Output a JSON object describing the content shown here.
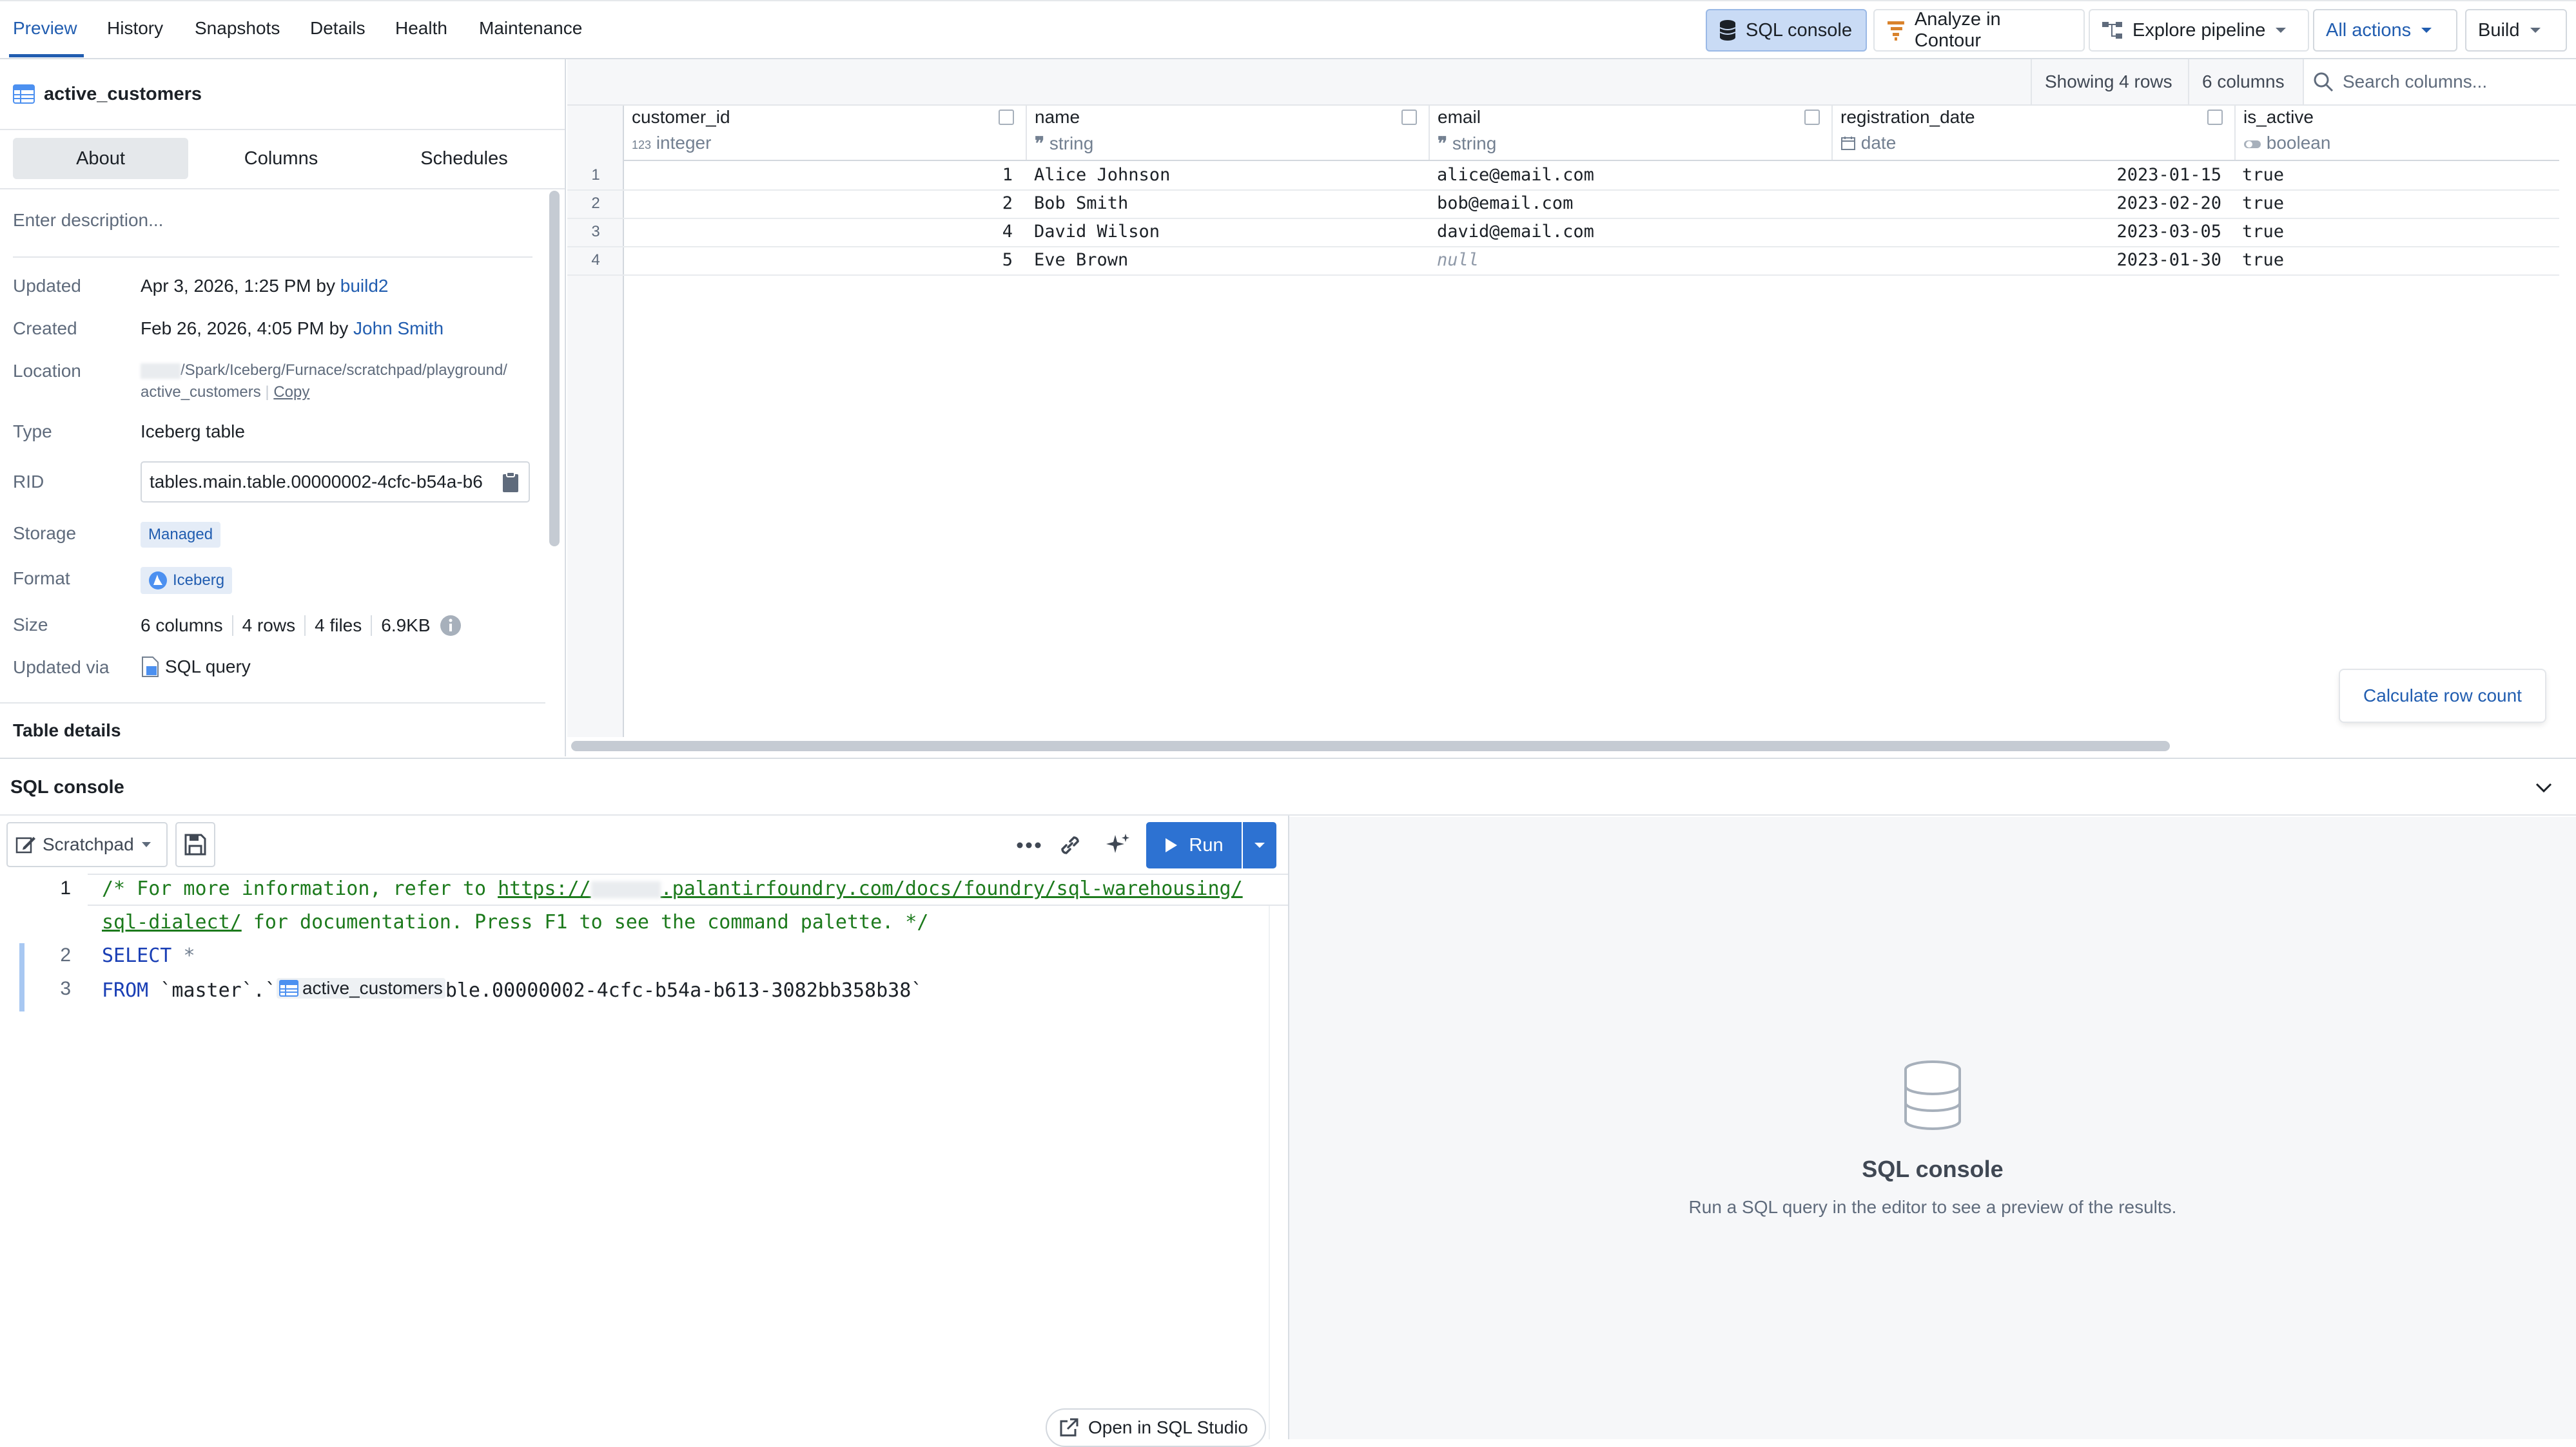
{
  "tabs": [
    {
      "label": "Preview",
      "active": true
    },
    {
      "label": "History"
    },
    {
      "label": "Snapshots"
    },
    {
      "label": "Details"
    },
    {
      "label": "Health"
    },
    {
      "label": "Maintenance"
    }
  ],
  "toolbar": {
    "sql_console": "SQL console",
    "analyze": "Analyze in Contour",
    "explore": "Explore pipeline",
    "all_actions": "All actions",
    "build": "Build"
  },
  "dataset": {
    "name": "active_customers",
    "subtabs": [
      "About",
      "Columns",
      "Schedules"
    ],
    "description_placeholder": "Enter description...",
    "updated_label": "Updated",
    "updated_text": "Apr 3, 2026, 1:25 PM by",
    "updated_by": "build2",
    "created_label": "Created",
    "created_text": "Feb 26, 2026, 4:05 PM by",
    "created_by": "John Smith",
    "location_label": "Location",
    "location_line1": "/Spark/Iceberg/Furnace/scratchpad/playground/",
    "location_line2": "active_customers",
    "copy": "Copy",
    "type_label": "Type",
    "type_value": "Iceberg table",
    "rid_label": "RID",
    "rid_value": "tables.main.table.00000002-4cfc-b54a-b6",
    "storage_label": "Storage",
    "storage_value": "Managed",
    "format_label": "Format",
    "format_value": "Iceberg",
    "size_label": "Size",
    "size_columns": "6 columns",
    "size_rows": "4 rows",
    "size_files": "4 files",
    "size_bytes": "6.9KB",
    "updated_via_label": "Updated via",
    "updated_via_value": "SQL query",
    "table_details": "Table details"
  },
  "grid": {
    "showing": "Showing 4 rows",
    "columns_count": "6 columns",
    "search_placeholder": "Search columns...",
    "columns": [
      {
        "name": "customer_id",
        "type": "integer",
        "type_icon": "123"
      },
      {
        "name": "name",
        "type": "string",
        "type_icon": "99"
      },
      {
        "name": "email",
        "type": "string",
        "type_icon": "99"
      },
      {
        "name": "registration_date",
        "type": "date",
        "type_icon": "calendar"
      },
      {
        "name": "is_active",
        "type": "boolean",
        "type_icon": "toggle"
      }
    ],
    "rows": [
      {
        "n": "1",
        "id": "1",
        "name": "Alice Johnson",
        "email": "alice@email.com",
        "date": "2023-01-15",
        "active": "true"
      },
      {
        "n": "2",
        "id": "2",
        "name": "Bob Smith",
        "email": "bob@email.com",
        "date": "2023-02-20",
        "active": "true"
      },
      {
        "n": "3",
        "id": "4",
        "name": "David Wilson",
        "email": "david@email.com",
        "date": "2023-03-05",
        "active": "true"
      },
      {
        "n": "4",
        "id": "5",
        "name": "Eve Brown",
        "email": "null",
        "date": "2023-01-30",
        "active": "true"
      }
    ],
    "calc_row_count": "Calculate row count"
  },
  "sql": {
    "title": "SQL console",
    "scratchpad": "Scratchpad",
    "run": "Run",
    "line_numbers": [
      "1",
      "2",
      "3"
    ],
    "comment_1a": "/* For more information, refer to ",
    "comment_link_a": "https://",
    "comment_link_b": ".palantirfoundry.com/docs/foundry/sql-warehousing/",
    "comment_link_c": "sql-dialect/",
    "comment_2b": " for documentation. Press F1 to see the command palette. */",
    "select_kw": "SELECT",
    "star": "*",
    "from_kw": "FROM",
    "from_ref": "`master`.`",
    "table_chip": "active_customers",
    "table_rest": "ble.00000002-4cfc-b54a-b613-3082bb358b38`",
    "open_studio": "Open in SQL Studio",
    "empty_title": "SQL console",
    "empty_text": "Run a SQL query in the editor to see a preview of the results."
  },
  "colors": {
    "accent": "#215db0",
    "primary_button_bg": "#c9dbf5",
    "run_button_bg": "#2d72d2",
    "comment_green": "#1c7a1c",
    "keyword_blue": "#1a3fb5"
  }
}
